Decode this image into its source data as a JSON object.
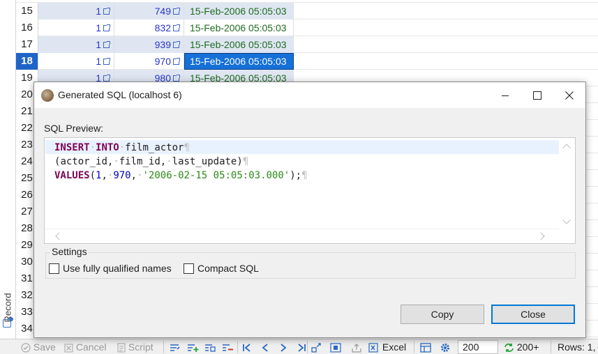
{
  "side_panel": {
    "label": "Record"
  },
  "grid": {
    "rows": [
      {
        "num": "15",
        "c1": "1",
        "c2": "749",
        "c3": "15-Feb-2006 05:05:03",
        "alt": true
      },
      {
        "num": "16",
        "c1": "1",
        "c2": "832",
        "c3": "15-Feb-2006 05:05:03",
        "alt": false
      },
      {
        "num": "17",
        "c1": "1",
        "c2": "939",
        "c3": "15-Feb-2006 05:05:03",
        "alt": true
      },
      {
        "num": "18",
        "c1": "1",
        "c2": "970",
        "c3": "15-Feb-2006 05:05:03",
        "alt": false,
        "selected": true
      },
      {
        "num": "19",
        "c1": "1",
        "c2": "980",
        "c3": "15-Feb-2006 05:05:03",
        "alt": true
      },
      {
        "num": "20"
      },
      {
        "num": "21"
      },
      {
        "num": "22"
      },
      {
        "num": "23"
      },
      {
        "num": "24"
      },
      {
        "num": "25"
      },
      {
        "num": "26"
      },
      {
        "num": "27"
      },
      {
        "num": "28"
      },
      {
        "num": "29"
      },
      {
        "num": "30"
      },
      {
        "num": "31"
      },
      {
        "num": "32"
      },
      {
        "num": "33"
      },
      {
        "num": "34"
      }
    ]
  },
  "dialog": {
    "title": "Generated SQL (localhost 6)",
    "preview_label": "SQL Preview:",
    "sql_lines": [
      "INSERT INTO film_actor",
      "(actor_id, film_id, last_update)",
      "VALUES(1, 970, '2006-02-15 05:05:03.000');"
    ],
    "settings_label": "Settings",
    "options": [
      {
        "label": "Use fully qualified names",
        "checked": false
      },
      {
        "label": "Compact SQL",
        "checked": false
      }
    ],
    "copy_label": "Copy",
    "close_label": "Close"
  },
  "toolbar": {
    "save": "Save",
    "cancel": "Cancel",
    "script": "Script",
    "excel": "Excel",
    "fetch_size": "200",
    "fetch_more": "200+",
    "rows_label": "Rows: 1,"
  },
  "colors": {
    "selection": "#1570d8",
    "accent": "#0078d7",
    "number_text": "#2a35c6",
    "date_text": "#1f6b1f"
  }
}
